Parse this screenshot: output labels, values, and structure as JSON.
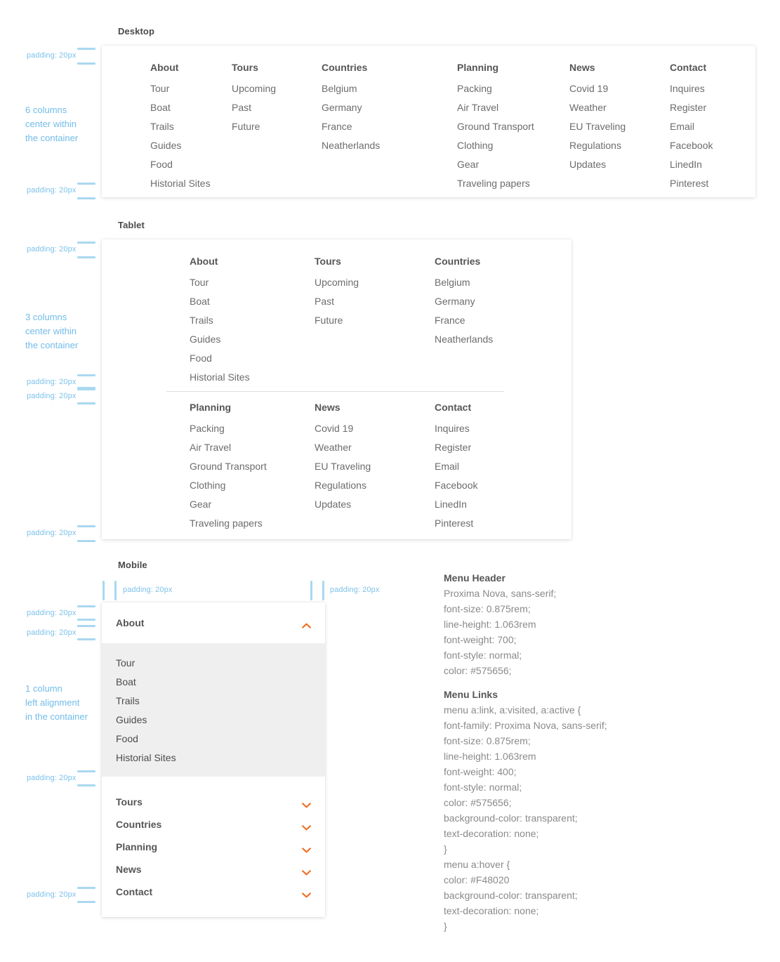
{
  "sections": {
    "desktop_label": "Desktop",
    "tablet_label": "Tablet",
    "mobile_label": "Mobile"
  },
  "annotations": {
    "padding_label": "padding: 20px",
    "desktop_note": "6 columns\ncenter within\nthe container",
    "tablet_note": "3 columns\ncenter within\nthe container",
    "mobile_note": "1 column\nleft alignment\nin the container"
  },
  "menu": {
    "columns": [
      {
        "heading": "About",
        "links": [
          "Tour",
          "Boat",
          "Trails",
          "Guides",
          "Food",
          "Historial Sites"
        ]
      },
      {
        "heading": "Tours",
        "links": [
          "Upcoming",
          "Past",
          "Future"
        ]
      },
      {
        "heading": "Countries",
        "links": [
          "Belgium",
          "Germany",
          "France",
          "Neatherlands"
        ]
      },
      {
        "heading": "Planning",
        "links": [
          "Packing",
          "Air Travel",
          "Ground Transport",
          "Clothing",
          "Gear",
          "Traveling papers"
        ]
      },
      {
        "heading": "News",
        "links": [
          "Covid 19",
          "Weather",
          "EU Traveling",
          "Regulations",
          "Updates"
        ]
      },
      {
        "heading": "Contact",
        "links": [
          "Inquires",
          "Register",
          "Email",
          "Facebook",
          "LinedIn",
          "Pinterest"
        ]
      }
    ]
  },
  "mobile": {
    "open_item": "About",
    "open_links": [
      "Tour",
      "Boat",
      "Trails",
      "Guides",
      "Food",
      "Historial Sites"
    ],
    "collapsed_items": [
      "Tours",
      "Countries",
      "Planning",
      "News",
      "Contact"
    ],
    "chevron_open_icon": "chevron-up-icon",
    "chevron_closed_icon": "chevron-down-icon",
    "chevron_color": "#F26B1D"
  },
  "spec": {
    "header_title": "Menu Header",
    "header_lines": [
      "Proxima Nova, sans-serif;",
      "font-size: 0.875rem;",
      "line-height: 1.063rem",
      "font-weight: 700;",
      "font-style: normal;",
      "color: #575656;"
    ],
    "links_title": "Menu Links",
    "links_lines": [
      "menu a:link, a:visited, a:active {",
      "font-family: Proxima Nova, sans-serif;",
      "font-size: 0.875rem;",
      "line-height: 1.063rem",
      "font-weight: 400;",
      "font-style: normal;",
      "color: #575656;",
      "background-color: transparent;",
      "text-decoration: none;",
      "}",
      "menu a:hover {",
      "color: #F48020",
      "background-color: transparent;",
      "text-decoration: none;",
      "}"
    ]
  },
  "colors": {
    "annotation_blue": "#7ec2ea",
    "marker_blue": "#a9d8f0",
    "accent_orange": "#F26B1D",
    "text_gray": "#575656",
    "link_gray": "#6d6c6c",
    "mobile_sub_bg": "#efefef"
  }
}
